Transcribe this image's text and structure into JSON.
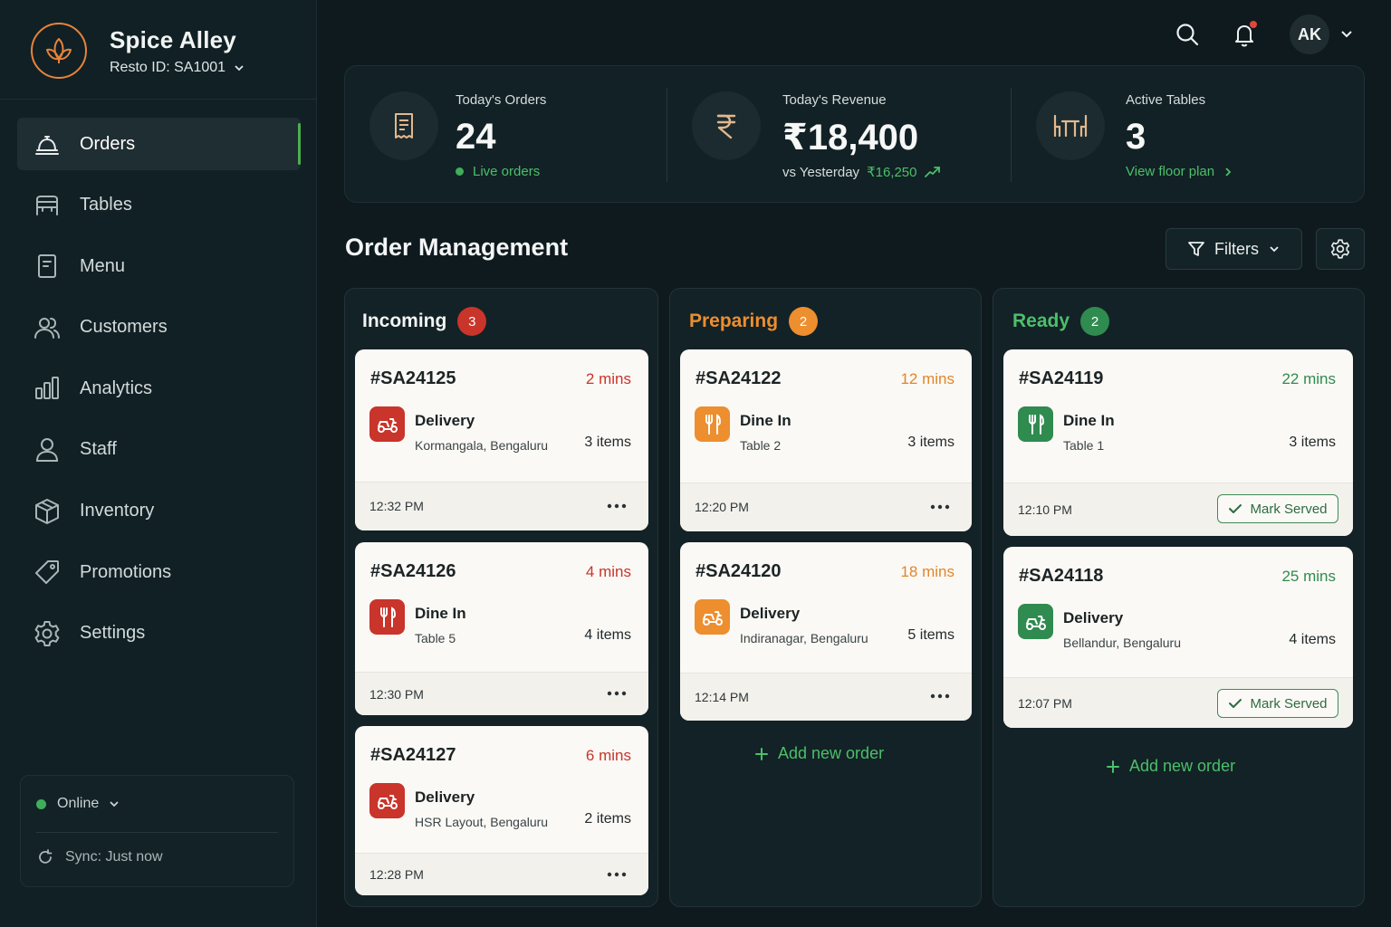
{
  "colors": {
    "background": "#0f1a1e",
    "sidebar": "#112024",
    "accent_orange": "#e8833a",
    "incoming_red": "#c9342b",
    "preparing_orange": "#ed8e2f",
    "ready_green": "#2f8b4f",
    "online_green": "#3fae5a"
  },
  "brand": {
    "name": "Spice Alley",
    "resto_id": "Resto ID: SA1001",
    "logo_icon": "leaf-icon"
  },
  "nav": {
    "items": [
      {
        "label": "Orders",
        "icon": "serving-cloche-icon",
        "active": true
      },
      {
        "label": "Tables",
        "icon": "table-icon",
        "active": false
      },
      {
        "label": "Menu",
        "icon": "menu-document-icon",
        "active": false
      },
      {
        "label": "Customers",
        "icon": "users-icon",
        "active": false
      },
      {
        "label": "Analytics",
        "icon": "bar-chart-icon",
        "active": false
      },
      {
        "label": "Staff",
        "icon": "person-icon",
        "active": false
      },
      {
        "label": "Inventory",
        "icon": "box-icon",
        "active": false
      },
      {
        "label": "Promotions",
        "icon": "tag-icon",
        "active": false
      },
      {
        "label": "Settings",
        "icon": "gear-icon",
        "active": false
      }
    ]
  },
  "status": {
    "online_label": "Online",
    "sync_label": "Sync: Just now"
  },
  "user": {
    "initials": "AK"
  },
  "stats": {
    "orders": {
      "label": "Today's Orders",
      "value": "24",
      "sub": "Live orders"
    },
    "revenue": {
      "label": "Today's Revenue",
      "value": "₹18,400",
      "sub_prefix": "vs Yesterday",
      "sub_value": "₹16,250"
    },
    "tables": {
      "label": "Active Tables",
      "value": "3",
      "link": "View floor plan"
    }
  },
  "order_management": {
    "title": "Order Management",
    "filters_label": "Filters",
    "add_new_label": "Add new order",
    "mark_served_label": "Mark Served"
  },
  "columns": [
    {
      "title": "Incoming",
      "count": "3",
      "orders": [
        {
          "id": "#SA24125",
          "ago": "2 mins",
          "type": "Delivery",
          "sub": "Kormangala, Bengaluru",
          "items": "3 items",
          "time": "12:32 PM"
        },
        {
          "id": "#SA24126",
          "ago": "4 mins",
          "type": "Dine In",
          "sub": "Table 5",
          "items": "4 items",
          "time": "12:30 PM"
        },
        {
          "id": "#SA24127",
          "ago": "6 mins",
          "type": "Delivery",
          "sub": "HSR Layout, Bengaluru",
          "items": "2 items",
          "time": "12:28 PM"
        }
      ]
    },
    {
      "title": "Preparing",
      "count": "2",
      "orders": [
        {
          "id": "#SA24122",
          "ago": "12 mins",
          "type": "Dine In",
          "sub": "Table 2",
          "items": "3 items",
          "time": "12:20 PM"
        },
        {
          "id": "#SA24120",
          "ago": "18 mins",
          "type": "Delivery",
          "sub": "Indiranagar, Bengaluru",
          "items": "5 items",
          "time": "12:14 PM"
        }
      ]
    },
    {
      "title": "Ready",
      "count": "2",
      "orders": [
        {
          "id": "#SA24119",
          "ago": "22 mins",
          "type": "Dine In",
          "sub": "Table 1",
          "items": "3 items",
          "time": "12:10 PM"
        },
        {
          "id": "#SA24118",
          "ago": "25 mins",
          "type": "Delivery",
          "sub": "Bellandur, Bengaluru",
          "items": "4 items",
          "time": "12:07 PM"
        }
      ]
    }
  ]
}
